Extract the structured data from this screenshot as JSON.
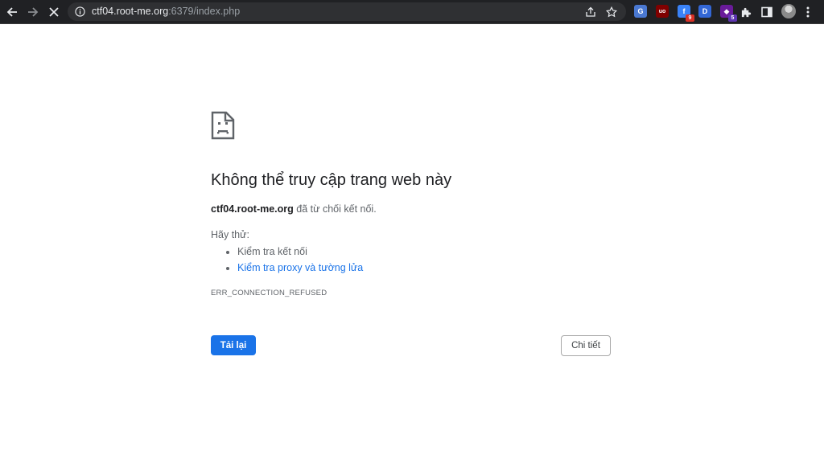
{
  "browser": {
    "url_host": "ctf04.root-me.org",
    "url_rest": ":6379/index.php",
    "extensions": [
      {
        "name": "translate",
        "color": "#4a78d1",
        "glyph": "G",
        "badge": ""
      },
      {
        "name": "ublock",
        "color": "#800000",
        "glyph": "uo",
        "badge": ""
      },
      {
        "name": "ext-3",
        "color": "#3a82f7",
        "glyph": "f",
        "badge": "9",
        "badge_color": "#d93025"
      },
      {
        "name": "ext-d",
        "color": "#3367d6",
        "glyph": "D",
        "badge": ""
      },
      {
        "name": "ext-5",
        "color": "#6a1b9a",
        "glyph": "◆",
        "badge": "5",
        "badge_color": "#5e35b1"
      }
    ]
  },
  "error": {
    "title": "Không thể truy cập trang web này",
    "host": "ctf04.root-me.org",
    "message": " đã từ chối kết nối.",
    "try_label": "Hãy thử:",
    "suggestions": [
      {
        "text": "Kiểm tra kết nối",
        "link": false
      },
      {
        "text": "Kiểm tra proxy và tường lửa",
        "link": true
      }
    ],
    "code": "ERR_CONNECTION_REFUSED",
    "reload_label": "Tải lại",
    "details_label": "Chi tiết"
  }
}
